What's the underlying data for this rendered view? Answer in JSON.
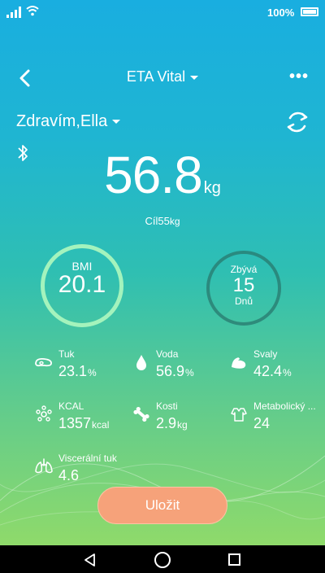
{
  "status_bar": {
    "battery_text": "100%",
    "signal_icon": "signal-icon",
    "wifi_icon": "wifi-icon",
    "battery_icon": "battery-icon"
  },
  "header": {
    "title": "ETA Vital",
    "back_icon": "chevron-left-icon",
    "more_icon": "more-icon",
    "more_glyph": "•••"
  },
  "user": {
    "greeting": "Zdravím,Ella"
  },
  "weight": {
    "value": "56.8",
    "unit": "kg",
    "goal_label": "Cíl",
    "goal_value": "55",
    "goal_unit": "kg"
  },
  "bmi": {
    "label": "BMI",
    "value": "20.1"
  },
  "remaining": {
    "label": "Zbývá",
    "value": "15",
    "unit": "Dnů"
  },
  "metrics": [
    {
      "label": "Tuk",
      "value": "23.1",
      "unit": "%",
      "icon": "fat-icon"
    },
    {
      "label": "Voda",
      "value": "56.9",
      "unit": "%",
      "icon": "water-drop-icon"
    },
    {
      "label": "Svaly",
      "value": "42.4",
      "unit": "%",
      "icon": "muscle-icon"
    },
    {
      "label": "KCAL",
      "value": "1357",
      "unit": "kcal",
      "icon": "metabolism-icon"
    },
    {
      "label": "Kosti",
      "value": "2.9",
      "unit": "kg",
      "icon": "bone-icon"
    },
    {
      "label": "Metabolický ...",
      "value": "24",
      "unit": "",
      "icon": "body-icon"
    },
    {
      "label": "Viscerální tuk",
      "value": "4.6",
      "unit": "",
      "icon": "lungs-icon"
    }
  ],
  "actions": {
    "save_label": "Uložit"
  },
  "colors": {
    "gradient_top": "#19aee0",
    "gradient_bottom": "#8fda6a",
    "save_button": "#f6a27a",
    "bmi_ring": "#aaf5be",
    "remaining_ring": "#28786e"
  }
}
